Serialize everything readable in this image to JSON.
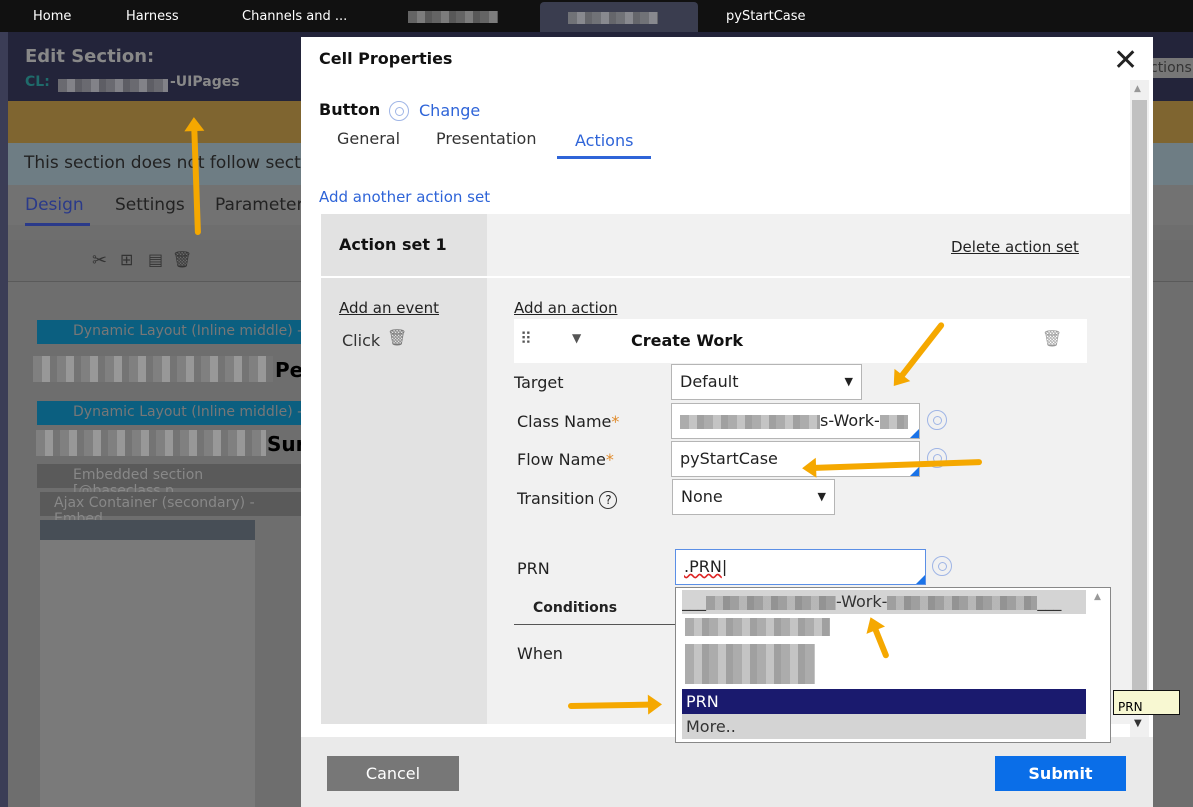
{
  "topbar": {
    "tabs": [
      "Home",
      "Harness",
      "Channels and ...",
      "pyStartCase"
    ]
  },
  "header": {
    "title": "Edit  Section:",
    "class_label": "CL:",
    "class_suffix": "-UIPages",
    "actions": "ctions"
  },
  "info_text": "This section does not follow sectio",
  "main_tabs": [
    "Design",
    "Settings",
    "Parameter"
  ],
  "canvas": {
    "dl1": "Dynamic Layout (Inline middle) -",
    "dl1_text": "Pe",
    "dl2": "Dynamic Layout (Inline middle) -",
    "dl2_text": "Sur",
    "embedded": "Embedded section [@baseclass.p",
    "ajax": "Ajax Container (secondary) - Embed"
  },
  "dialog": {
    "title": "Cell Properties",
    "control": "Button",
    "change": "Change",
    "tabs": [
      "General",
      "Presentation",
      "Actions"
    ],
    "active_tab": "Actions",
    "add_action_set": "Add another action set",
    "action_set": "Action set 1",
    "delete_action_set": "Delete action set",
    "add_event": "Add an event",
    "event": "Click",
    "add_action": "Add an action",
    "action": "Create Work",
    "fields": {
      "target_label": "Target",
      "target_value": "Default",
      "class_label": "Class Name",
      "class_value_suffix": "s-Work-",
      "flow_label": "Flow Name",
      "flow_value": "pyStartCase",
      "transition_label": "Transition",
      "transition_value": "None",
      "prn_label": "PRN",
      "prn_value": ".PRN",
      "conditions": "Conditions",
      "when": "When"
    },
    "dropdown": {
      "header_mid": "-Work-",
      "options": [
        "PRN",
        "More.."
      ],
      "selected": "PRN"
    },
    "tooltip": "PRN",
    "cancel": "Cancel",
    "submit": "Submit"
  },
  "colors": {
    "accent": "#2e64d8",
    "submit": "#0a6ee8",
    "highlight": "#1a1a6e",
    "arrow": "#f5a800"
  }
}
